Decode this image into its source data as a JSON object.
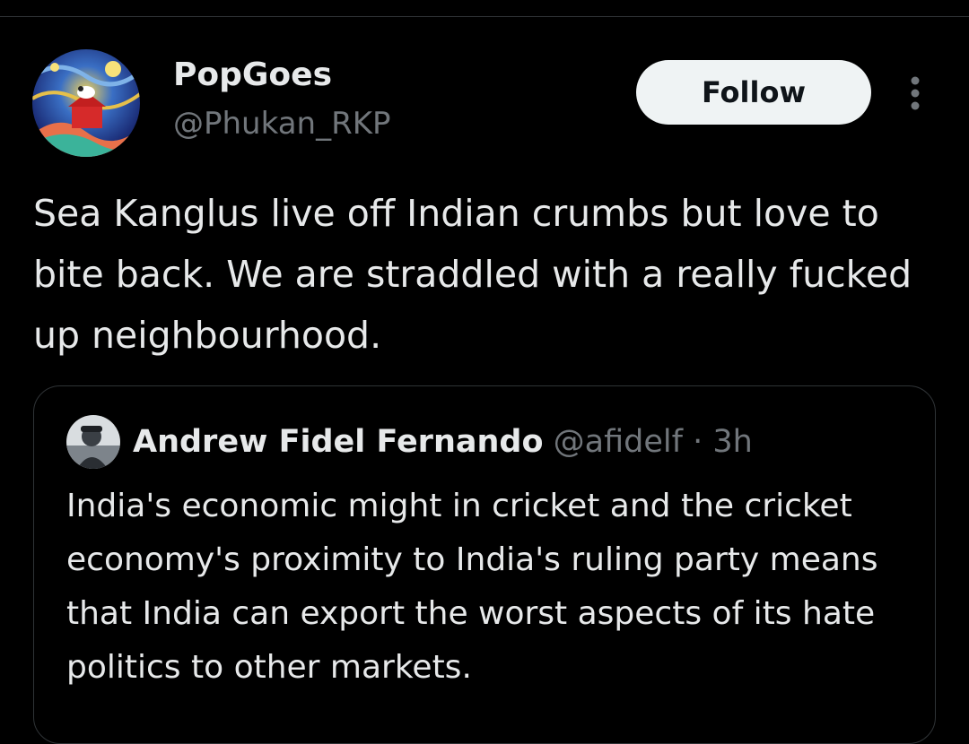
{
  "tweet": {
    "author": {
      "display_name": "PopGoes",
      "handle": "@Phukan_RKP"
    },
    "follow_label": "Follow",
    "text": "Sea Kanglus live off Indian crumbs but love to bite back. We are straddled with a really fucked up neighbourhood."
  },
  "quoted_tweet": {
    "author": {
      "display_name": "Andrew Fidel Fernando",
      "handle": "@afidelf"
    },
    "separator": "·",
    "time": "3h",
    "text": "India's economic might in cricket and the cricket economy's proximity to India's ruling party means that India can export the worst aspects of its hate politics to other markets."
  },
  "icons": {
    "more": "more-vertical-icon"
  },
  "colors": {
    "background": "#000000",
    "primary_text": "#e7e9ea",
    "secondary_text": "#71767b",
    "border": "#2f3336",
    "follow_button_bg": "#eff3f4",
    "follow_button_text": "#0f1419"
  }
}
